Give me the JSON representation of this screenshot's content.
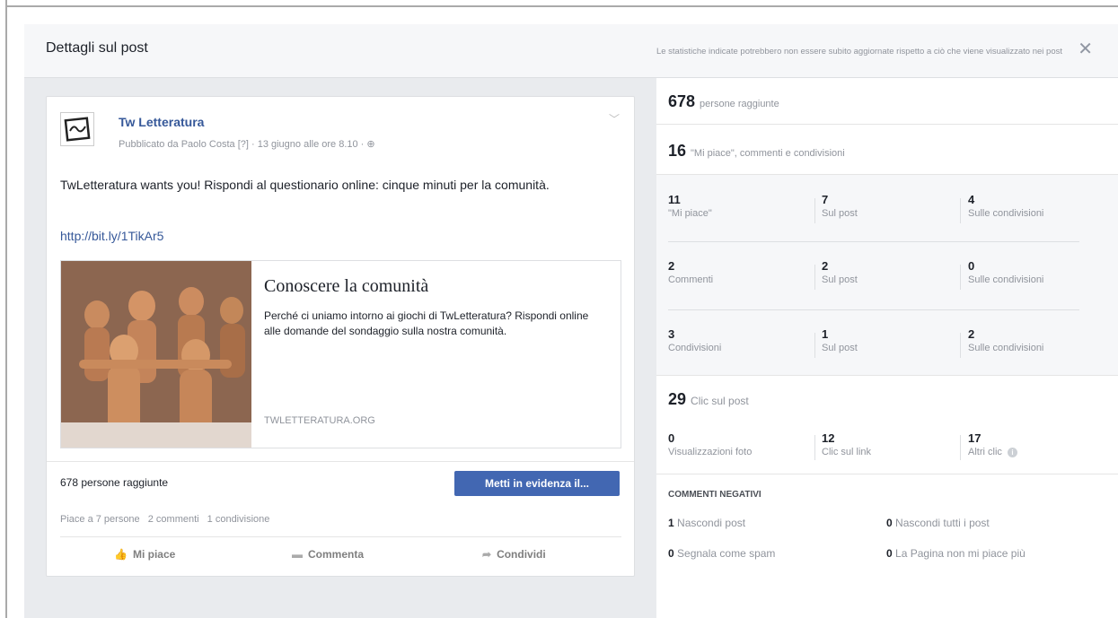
{
  "modal": {
    "title": "Dettagli sul post",
    "note": "Le statistiche indicate potrebbero non essere subito aggiornate rispetto a ciò che viene visualizzato nei post",
    "close": "✕"
  },
  "post": {
    "page_name": "Tw Letteratura",
    "meta": "Pubblicato da Paolo Costa [?] · 13 giugno alle ore 8.10 · ⊕",
    "text": "TwLetteratura wants you! Rispondi al questionario online: cinque minuti per la comunità.",
    "link": "http://bit.ly/1TikAr5",
    "card": {
      "title": "Conoscere la comunità",
      "description": "Perché ci uniamo intorno ai giochi di TwLetteratura? Rispondi online alle domande del sondaggio sulla nostra comunità.",
      "domain": "TWLETTERATURA.ORG"
    },
    "reach": "678 persone raggiunte",
    "boost_label": "Metti in evidenza il...",
    "stats": {
      "likes": "Piace a 7 persone",
      "comments": "2 commenti",
      "shares": "1 condivisione"
    },
    "actions": {
      "like": "Mi piace",
      "comment": "Commenta",
      "share": "Condividi"
    }
  },
  "insights": {
    "reach_num": "678",
    "reach_label": "persone raggiunte",
    "engagement_num": "16",
    "engagement_label": "\"Mi piace\", commenti e condivisioni",
    "rows": [
      [
        {
          "num": "11",
          "label": "\"Mi piace\""
        },
        {
          "num": "7",
          "label": "Sul post"
        },
        {
          "num": "4",
          "label": "Sulle condivisioni"
        }
      ],
      [
        {
          "num": "2",
          "label": "Commenti"
        },
        {
          "num": "2",
          "label": "Sul post"
        },
        {
          "num": "0",
          "label": "Sulle condivisioni"
        }
      ],
      [
        {
          "num": "3",
          "label": "Condivisioni"
        },
        {
          "num": "1",
          "label": "Sul post"
        },
        {
          "num": "2",
          "label": "Sulle condivisioni"
        }
      ]
    ],
    "clicks_num": "29",
    "clicks_label": "Clic sul post",
    "click_cells": [
      {
        "num": "0",
        "label": "Visualizzazioni foto"
      },
      {
        "num": "12",
        "label": "Clic sul link"
      },
      {
        "num": "17",
        "label": "Altri clic"
      }
    ],
    "negative": {
      "title": "COMMENTI NEGATIVI",
      "items": [
        {
          "num": "1",
          "label": "Nascondi post"
        },
        {
          "num": "0",
          "label": "Nascondi tutti i post"
        },
        {
          "num": "0",
          "label": "Segnala come spam"
        },
        {
          "num": "0",
          "label": "La Pagina non mi piace più"
        }
      ]
    }
  },
  "icons": {
    "info": "i",
    "chevron": "﹀",
    "like": "👍",
    "comment": "▬",
    "share": "➦"
  }
}
